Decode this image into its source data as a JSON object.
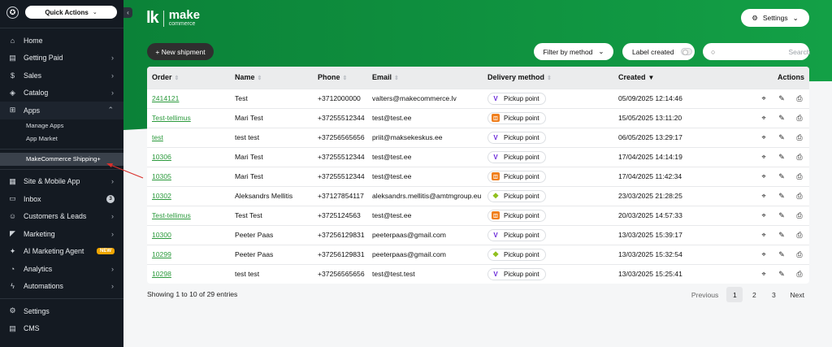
{
  "sidebar": {
    "quick_actions_label": "Quick Actions",
    "items": [
      {
        "label": "Home",
        "icon": "home-icon"
      },
      {
        "label": "Getting Paid",
        "icon": "card-icon"
      },
      {
        "label": "Sales",
        "icon": "dollar-icon"
      },
      {
        "label": "Catalog",
        "icon": "tag-icon"
      },
      {
        "label": "Apps",
        "icon": "apps-icon"
      }
    ],
    "apps_sub": [
      {
        "label": "Manage Apps"
      },
      {
        "label": "App Market"
      }
    ],
    "active_app": "MakeCommerce Shipping+",
    "items2": [
      {
        "label": "Site & Mobile App"
      },
      {
        "label": "Inbox",
        "badge": "3"
      },
      {
        "label": "Customers & Leads"
      },
      {
        "label": "Marketing"
      },
      {
        "label": "AI Marketing Agent",
        "new_badge": "NEW"
      },
      {
        "label": "Analytics"
      },
      {
        "label": "Automations"
      }
    ],
    "items3": [
      {
        "label": "Settings"
      },
      {
        "label": "CMS"
      }
    ]
  },
  "brand": {
    "mark": "lk",
    "name": "make",
    "sub": "commerce"
  },
  "toolbar": {
    "settings_label": "Settings",
    "new_shipment_label": "+ New shipment",
    "filter_label": "Filter by method",
    "label_created_label": "Label created",
    "search_placeholder": "Search"
  },
  "table": {
    "headers": {
      "order": "Order",
      "name": "Name",
      "phone": "Phone",
      "email": "Email",
      "delivery": "Delivery method",
      "created": "Created",
      "actions": "Actions"
    },
    "rows": [
      {
        "order": "2414121",
        "name": "Test",
        "phone": "+3712000000",
        "email": "valters@makecommerce.lv",
        "carrier": "v",
        "method": "Pickup point",
        "created": "05/09/2025 12:14:46"
      },
      {
        "order": "Test-tellimus",
        "name": "Mari Test",
        "phone": "+37255512344",
        "email": "test@test.ee",
        "carrier": "o",
        "method": "Pickup point",
        "created": "15/05/2025 13:11:20"
      },
      {
        "order": "test",
        "name": "test test",
        "phone": "+37256565656",
        "email": "priit@maksekeskus.ee",
        "carrier": "v",
        "method": "Pickup point",
        "created": "06/05/2025 13:29:17"
      },
      {
        "order": "10306",
        "name": "Mari Test",
        "phone": "+37255512344",
        "email": "test@test.ee",
        "carrier": "v",
        "method": "Pickup point",
        "created": "17/04/2025 14:14:19"
      },
      {
        "order": "10305",
        "name": "Mari Test",
        "phone": "+37255512344",
        "email": "test@test.ee",
        "carrier": "o",
        "method": "Pickup point",
        "created": "17/04/2025 11:42:34"
      },
      {
        "order": "10302",
        "name": "Aleksandrs Mellitis",
        "phone": "+37127854117",
        "email": "aleksandrs.mellitis@amtmgroup.eu",
        "carrier": "g",
        "method": "Pickup point",
        "created": "23/03/2025 21:28:25"
      },
      {
        "order": "Test-tellimus",
        "name": "Test Test",
        "phone": "+3725124563",
        "email": "test@test.ee",
        "carrier": "o",
        "method": "Pickup point",
        "created": "20/03/2025 14:57:33"
      },
      {
        "order": "10300",
        "name": "Peeter Paas",
        "phone": "+37256129831",
        "email": "peeterpaas@gmail.com",
        "carrier": "v",
        "method": "Pickup point",
        "created": "13/03/2025 15:39:17"
      },
      {
        "order": "10299",
        "name": "Peeter Paas",
        "phone": "+37256129831",
        "email": "peeterpaas@gmail.com",
        "carrier": "g",
        "method": "Pickup point",
        "created": "13/03/2025 15:32:54"
      },
      {
        "order": "10298",
        "name": "test test",
        "phone": "+37256565656",
        "email": "test@test.test",
        "carrier": "v",
        "method": "Pickup point",
        "created": "13/03/2025 15:25:41"
      }
    ]
  },
  "footer": {
    "showing": "Showing 1 to 10 of 29 entries",
    "previous": "Previous",
    "pages": [
      "1",
      "2",
      "3"
    ],
    "next": "Next"
  },
  "colors": {
    "brand_green": "#0f8a3c",
    "link_green": "#2b9a3c",
    "sidebar_bg": "#141a22"
  }
}
